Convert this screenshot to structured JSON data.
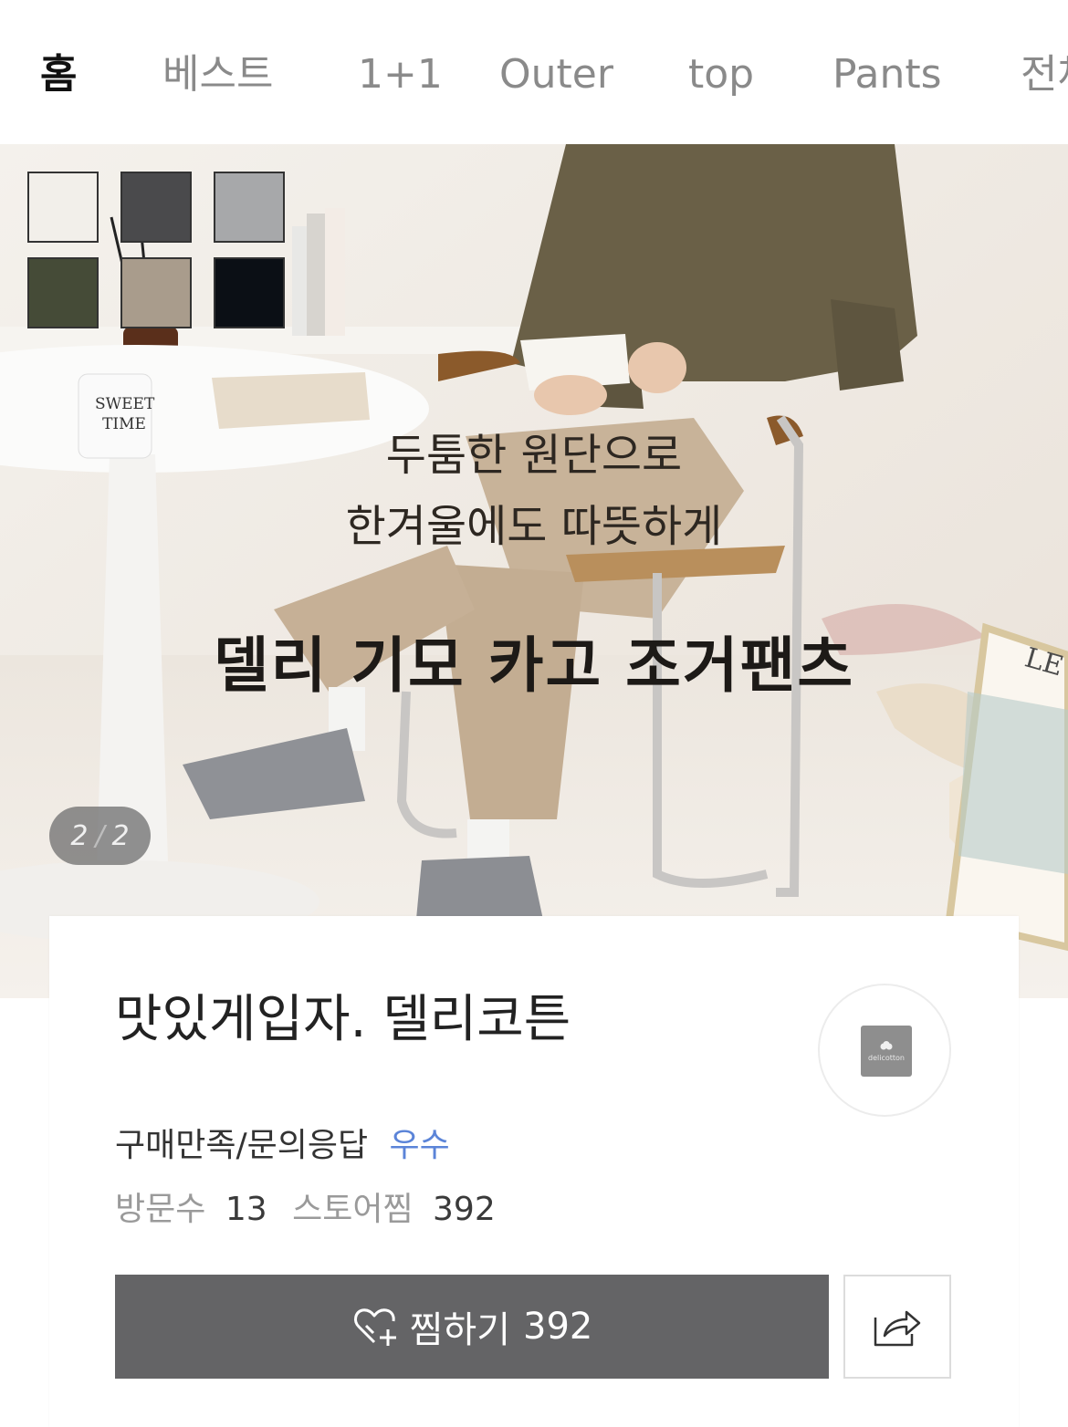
{
  "tabs": [
    {
      "label": "홈",
      "active": true
    },
    {
      "label": "베스트",
      "active": false
    },
    {
      "label": "1+1",
      "active": false
    },
    {
      "label": "Outer",
      "active": false
    },
    {
      "label": "top",
      "active": false
    },
    {
      "label": "Pants",
      "active": false
    },
    {
      "label": "전체",
      "active": false
    }
  ],
  "banner": {
    "swatch_colors": [
      "#f2efea",
      "#4a4a4c",
      "#a7a8aa",
      "#454b37",
      "#a99c8c",
      "#0b0f15"
    ],
    "copy_line1": "두툼한 원단으로",
    "copy_line2": "한겨울에도 따뜻하게",
    "title": "델리 기모 카고 조거팬츠",
    "mug_text_1": "SWEET",
    "mug_text_2": "TIME",
    "frame_text": "LE M",
    "pager": {
      "current": "2",
      "separator": "/",
      "total": "2"
    }
  },
  "store": {
    "name": "맛있게입자. 델리코튼",
    "logo_text": "delicotton",
    "rating_label": "구매만족/문의응답",
    "rating_value": "우수",
    "visits_label": "방문수",
    "visits_value": "13",
    "zzim_label": "스토어찜",
    "zzim_value": "392"
  },
  "actions": {
    "zzim_button_label": "찜하기",
    "zzim_button_count": "392",
    "share_icon": "share-icon",
    "heart_icon": "heart-plus-icon"
  }
}
